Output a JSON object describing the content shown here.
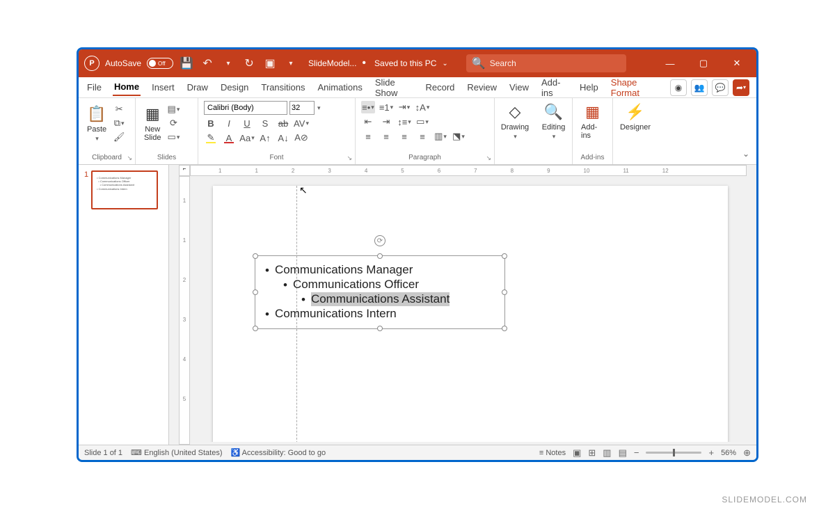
{
  "titlebar": {
    "autosave_label": "AutoSave",
    "autosave_state": "Off",
    "filename": "SlideModel...",
    "saved_status": "Saved to this PC",
    "search_placeholder": "Search"
  },
  "menu": {
    "tabs": [
      "File",
      "Home",
      "Insert",
      "Draw",
      "Design",
      "Transitions",
      "Animations",
      "Slide Show",
      "Record",
      "Review",
      "View",
      "Add-ins",
      "Help"
    ],
    "context_tab": "Shape Format",
    "active": "Home"
  },
  "ribbon": {
    "clipboard": {
      "paste": "Paste",
      "label": "Clipboard"
    },
    "slides": {
      "new_slide": "New\nSlide",
      "label": "Slides"
    },
    "font": {
      "name": "Calibri (Body)",
      "size": "32",
      "label": "Font"
    },
    "paragraph": {
      "label": "Paragraph"
    },
    "drawing": {
      "btn": "Drawing",
      "label": ""
    },
    "editing": {
      "btn": "Editing"
    },
    "addins": {
      "btn": "Add-ins",
      "label": "Add-ins"
    },
    "designer": {
      "btn": "Designer"
    }
  },
  "thumbnails": {
    "items": [
      {
        "num": "1"
      }
    ]
  },
  "ruler_h": [
    "1",
    "1",
    "2",
    "3",
    "4",
    "5",
    "6",
    "7",
    "8",
    "9",
    "10",
    "11",
    "12"
  ],
  "ruler_v": [
    "1",
    "1",
    "2",
    "3",
    "4",
    "5"
  ],
  "slide": {
    "bullets": [
      {
        "level": 0,
        "text": "Communications Manager",
        "hl": false
      },
      {
        "level": 1,
        "text": "Communications Officer",
        "hl": false
      },
      {
        "level": 2,
        "text": "Communications Assistant",
        "hl": true
      },
      {
        "level": 0,
        "text": "Communications Intern",
        "hl": false
      }
    ]
  },
  "status": {
    "slide_pos": "Slide 1 of 1",
    "lang": "English (United States)",
    "access": "Accessibility: Good to go",
    "notes": "Notes",
    "zoom": "56%"
  },
  "watermark": "SLIDEMODEL.COM"
}
